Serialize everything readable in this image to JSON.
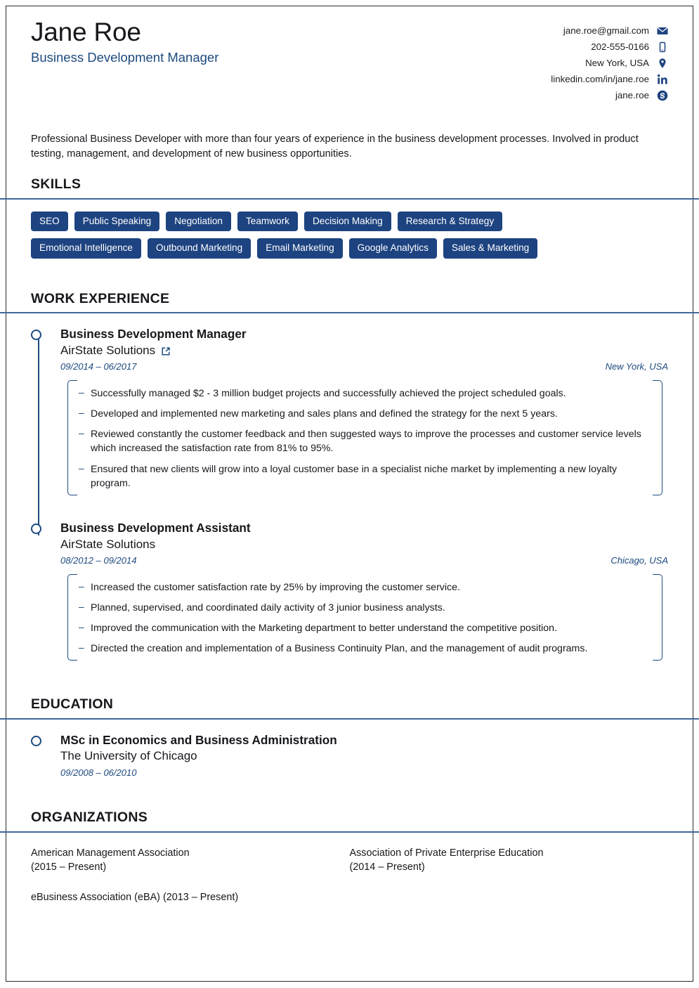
{
  "header": {
    "name": "Jane Roe",
    "job_title": "Business Development Manager",
    "contacts": [
      {
        "value": "jane.roe@gmail.com",
        "icon": "envelope-icon"
      },
      {
        "value": "202-555-0166",
        "icon": "phone-icon"
      },
      {
        "value": "New York, USA",
        "icon": "location-pin-icon"
      },
      {
        "value": "linkedin.com/in/jane.roe",
        "icon": "linkedin-icon"
      },
      {
        "value": "jane.roe",
        "icon": "skype-icon"
      }
    ]
  },
  "summary": {
    "text": "Professional Business Developer with more than four years of experience in the business development processes. Involved in product testing, management, and development of new business opportunities."
  },
  "skills": {
    "title": "SKILLS",
    "rows": [
      [
        "SEO",
        "Public Speaking",
        "Negotiation",
        "Teamwork",
        "Decision Making",
        "Research & Strategy"
      ],
      [
        "Emotional Intelligence",
        "Outbound Marketing",
        "Email Marketing",
        "Google Analytics",
        "Sales & Marketing"
      ]
    ]
  },
  "work_experience": {
    "title": "WORK EXPERIENCE",
    "entries": [
      {
        "role": "Business Development Manager",
        "organization": "AirState Solutions",
        "has_link": true,
        "date": "09/2014 – 06/2017",
        "location": "New York, USA",
        "bullets": [
          "Successfully managed $2 - 3 million budget projects and successfully achieved the project scheduled goals.",
          "Developed and implemented new marketing and sales plans and defined the strategy for the next 5 years.",
          "Reviewed constantly the customer feedback and then suggested ways to improve the processes and customer service levels which increased the satisfaction rate from 81% to 95%.",
          "Ensured that new clients will grow into a loyal customer base in a specialist niche market by implementing a new loyalty program."
        ]
      },
      {
        "role": "Business Development Assistant",
        "organization": "AirState Solutions",
        "has_link": false,
        "date": "08/2012 – 09/2014",
        "location": "Chicago, USA",
        "bullets": [
          "Increased the customer satisfaction rate by 25% by improving the customer service.",
          "Planned, supervised, and coordinated daily activity of 3 junior business analysts.",
          "Improved the communication with the Marketing department to better understand the competitive position.",
          "Directed the creation and implementation of a Business Continuity Plan, and the management of audit programs."
        ]
      }
    ]
  },
  "education": {
    "title": "EDUCATION",
    "entries": [
      {
        "degree": "MSc in Economics and Business Administration",
        "school": "The University of Chicago",
        "date": "09/2008 – 06/2010"
      }
    ]
  },
  "organizations": {
    "title": "ORGANIZATIONS",
    "column_left": [
      "American Management Association\n(2015 – Present)",
      "eBusiness Association (eBA) (2013 – Present)"
    ],
    "column_right": [
      "Association of Private Enterprise Education\n(2014 – Present)"
    ]
  },
  "colors": {
    "accent_navy": "#1d4a7e",
    "pill_navy": "#1d4380",
    "rule_blue": "#41679a",
    "text_dark": "#16181c"
  }
}
